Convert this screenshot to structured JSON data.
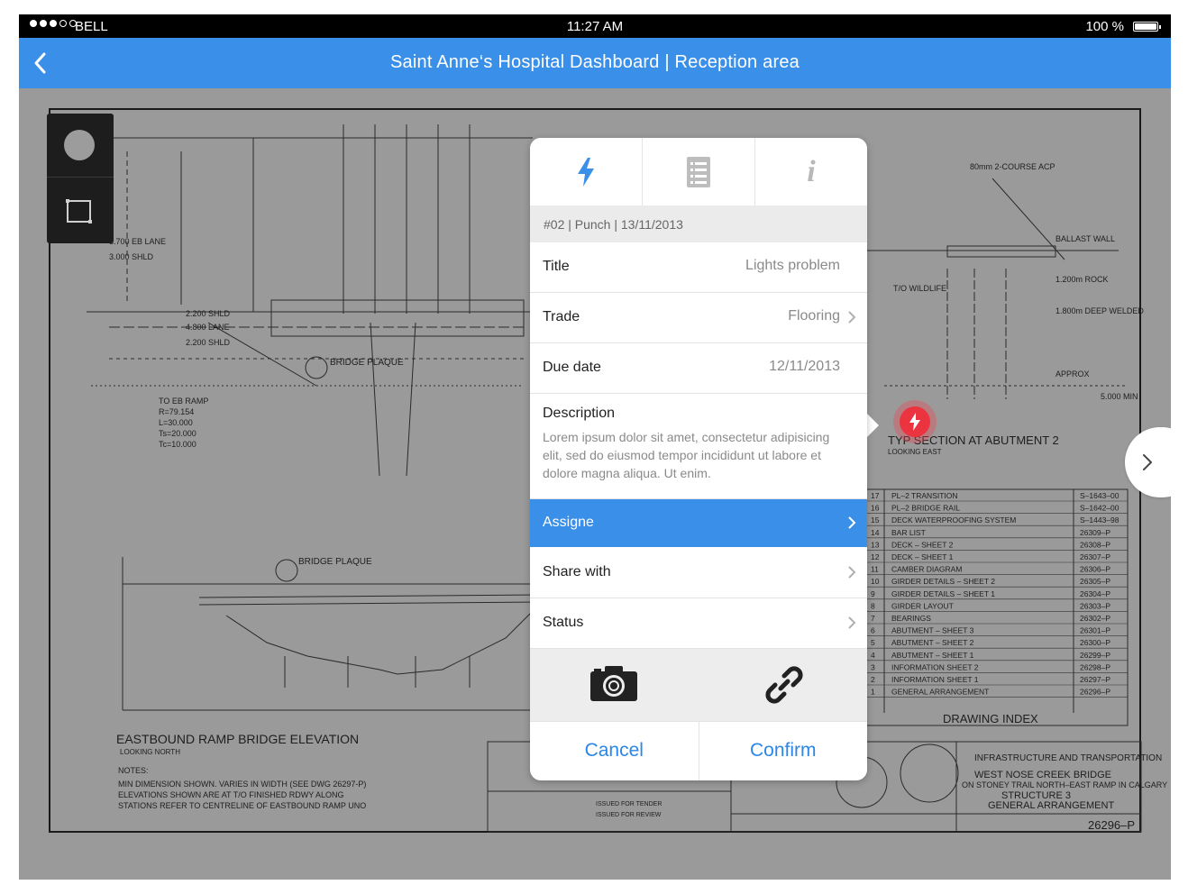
{
  "status_bar": {
    "carrier": "BELL",
    "time": "11:27 AM",
    "battery": "100 %"
  },
  "nav": {
    "title": "Saint Anne‘s Hospital Dashboard | Reception area",
    "back_icon": "chevron-left-icon"
  },
  "drawing": {
    "bridge_elevation_title": "EASTBOUND  RAMP  BRIDGE  ELEVATION",
    "bridge_elevation_sub": "LOOKING NORTH",
    "section_title": "TYP  SECTION  AT  ABUTMENT  2",
    "section_sub": "LOOKING EAST",
    "index_title": "DRAWING  INDEX",
    "index_rows": [
      [
        "17",
        "PL–2  TRANSITION",
        "S–1643–00"
      ],
      [
        "16",
        "PL–2  BRIDGE  RAIL",
        "S–1642–00"
      ],
      [
        "15",
        "DECK  WATERPROOFING  SYSTEM",
        "S–1443–98"
      ],
      [
        "14",
        "BAR  LIST",
        "26309–P"
      ],
      [
        "13",
        "DECK  –  SHEET  2",
        "26308–P"
      ],
      [
        "12",
        "DECK  –  SHEET  1",
        "26307–P"
      ],
      [
        "11",
        "CAMBER  DIAGRAM",
        "26306–P"
      ],
      [
        "10",
        "GIRDER  DETAILS  –  SHEET  2",
        "26305–P"
      ],
      [
        "9",
        "GIRDER  DETAILS  –  SHEET  1",
        "26304–P"
      ],
      [
        "8",
        "GIRDER  LAYOUT",
        "26303–P"
      ],
      [
        "7",
        "BEARINGS",
        "26302–P"
      ],
      [
        "6",
        "ABUTMENT  –  SHEET  3",
        "26301–P"
      ],
      [
        "5",
        "ABUTMENT  –  SHEET  2",
        "26300–P"
      ],
      [
        "4",
        "ABUTMENT  –  SHEET  1",
        "26299–P"
      ],
      [
        "3",
        "INFORMATION  SHEET  2",
        "26298–P"
      ],
      [
        "2",
        "INFORMATION  SHEET  1",
        "26297–P"
      ],
      [
        "1",
        "GENERAL  ARRANGEMENT",
        "26296–P"
      ]
    ],
    "title_block_line1": "WEST  NOSE  CREEK  BRIDGE",
    "title_block_line2": "ON  STONEY  TRAIL  NORTH–EAST  RAMP  IN  CALGARY",
    "title_block_line3": "STRUCTURE  3",
    "title_block_line4": "GENERAL  ARRANGEMENT",
    "authority": "INFRASTRUCTURE  AND  TRANSPORTATION",
    "drawing_no": "26296–P",
    "plaque_label": "BRIDGE PLAQUE",
    "revision_1": "ISSUED FOR TENDER",
    "revision_2": "ISSUED FOR REVIEW"
  },
  "tools": {
    "circle_icon": "circle-tool-icon",
    "rect_icon": "rectangle-tool-icon"
  },
  "popover": {
    "tabs": [
      {
        "icon": "lightning-icon",
        "active": true
      },
      {
        "icon": "list-document-icon",
        "active": false
      },
      {
        "icon": "info-icon",
        "label": "i",
        "active": false
      }
    ],
    "meta": "#02  |  Punch  |  13/11/2013",
    "rows": {
      "title": {
        "label": "Title",
        "value": "Lights problem"
      },
      "trade": {
        "label": "Trade",
        "value": "Flooring"
      },
      "due_date": {
        "label": "Due date",
        "value": "12/11/2013"
      },
      "description": {
        "label": "Description",
        "value": "Lorem ipsum dolor sit amet, consectetur adipisicing elit, sed do eiusmod tempor incididunt ut labore et dolore magna aliqua. Ut enim."
      },
      "assignee": {
        "label": "Assigne"
      },
      "share_with": {
        "label": "Share with"
      },
      "status": {
        "label": "Status"
      }
    },
    "media": {
      "camera_icon": "camera-icon",
      "link_icon": "link-icon"
    },
    "actions": {
      "cancel": "Cancel",
      "confirm": "Confirm"
    }
  },
  "colors": {
    "accent": "#3a8fe8",
    "pin": "#ec3340",
    "drawing_bg": "#9a9a9a"
  }
}
